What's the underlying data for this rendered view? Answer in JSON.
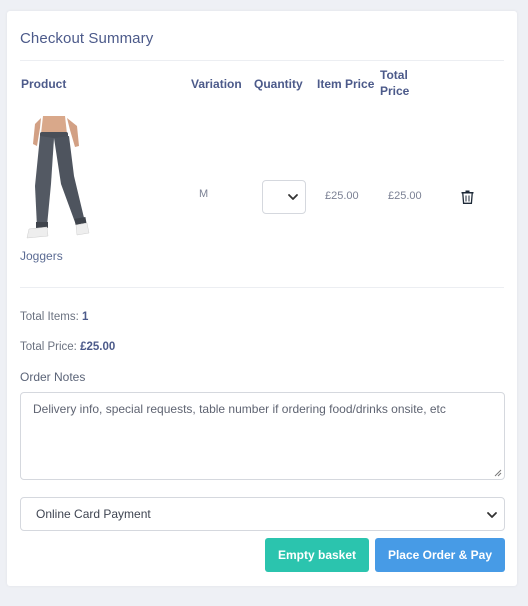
{
  "title": "Checkout Summary",
  "table": {
    "headers": {
      "product": "Product",
      "variation": "Variation",
      "quantity": "Quantity",
      "item_price": "Item Price",
      "total_price_line1": "Total",
      "total_price_line2": "Price"
    },
    "rows": [
      {
        "product_name": "Joggers",
        "variation": "M",
        "quantity": "",
        "item_price": "£25.00",
        "total_price": "£25.00"
      }
    ]
  },
  "totals": {
    "items_label": "Total Items:",
    "items_value": "1",
    "price_label": "Total Price:",
    "price_value": "£25.00"
  },
  "notes": {
    "label": "Order Notes",
    "placeholder": "Delivery info, special requests, table number if ordering food/drinks onsite, etc"
  },
  "payment": {
    "selected": "Online Card Payment"
  },
  "buttons": {
    "empty": "Empty basket",
    "order": "Place Order & Pay"
  },
  "colors": {
    "accent_teal": "#2bc4ae",
    "accent_blue": "#479be6",
    "heading": "#4c5a8a"
  }
}
